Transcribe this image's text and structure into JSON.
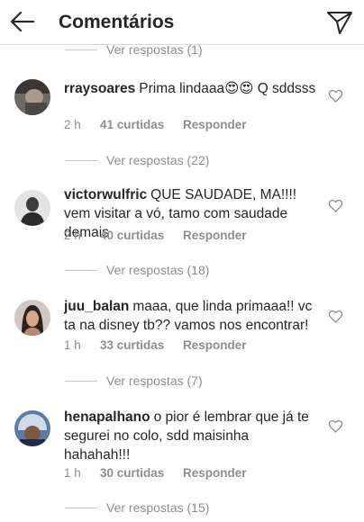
{
  "header": {
    "title": "Comentários",
    "back_icon": "arrow-left-icon",
    "send_icon": "send-paper-plane-icon"
  },
  "top_replies": {
    "label": "Ver respostas (1)"
  },
  "comments": [
    {
      "username": "rraysoares",
      "text": "Prima lindaaa😍😍 Q sddsss",
      "time": "2 h",
      "likes": "41 curtidas",
      "reply": "Responder",
      "replies": "Ver respostas (22)"
    },
    {
      "username": "victorwulfric",
      "text": "QUE SAUDADE, MA!!!! vem visitar a vó, tamo com saudade demais",
      "time": "2 h",
      "likes": "40 curtidas",
      "reply": "Responder",
      "replies": "Ver respostas (18)"
    },
    {
      "username": "juu_balan",
      "text": "maaa, que linda primaaa!! vc ta na disney tb?? vamos nos encontrar!",
      "time": "1 h",
      "likes": "33 curtidas",
      "reply": "Responder",
      "replies": "Ver respostas (7)"
    },
    {
      "username": "henapalhano",
      "text": "o pior é lembrar que já te segurei no colo, sdd maisinha hahahah!!!",
      "time": "1 h",
      "likes": "30 curtidas",
      "reply": "Responder",
      "replies": "Ver respostas (15)"
    }
  ],
  "colors": {
    "text": "#262626",
    "muted": "#8e8e8e",
    "divider": "#dbdbdb"
  }
}
